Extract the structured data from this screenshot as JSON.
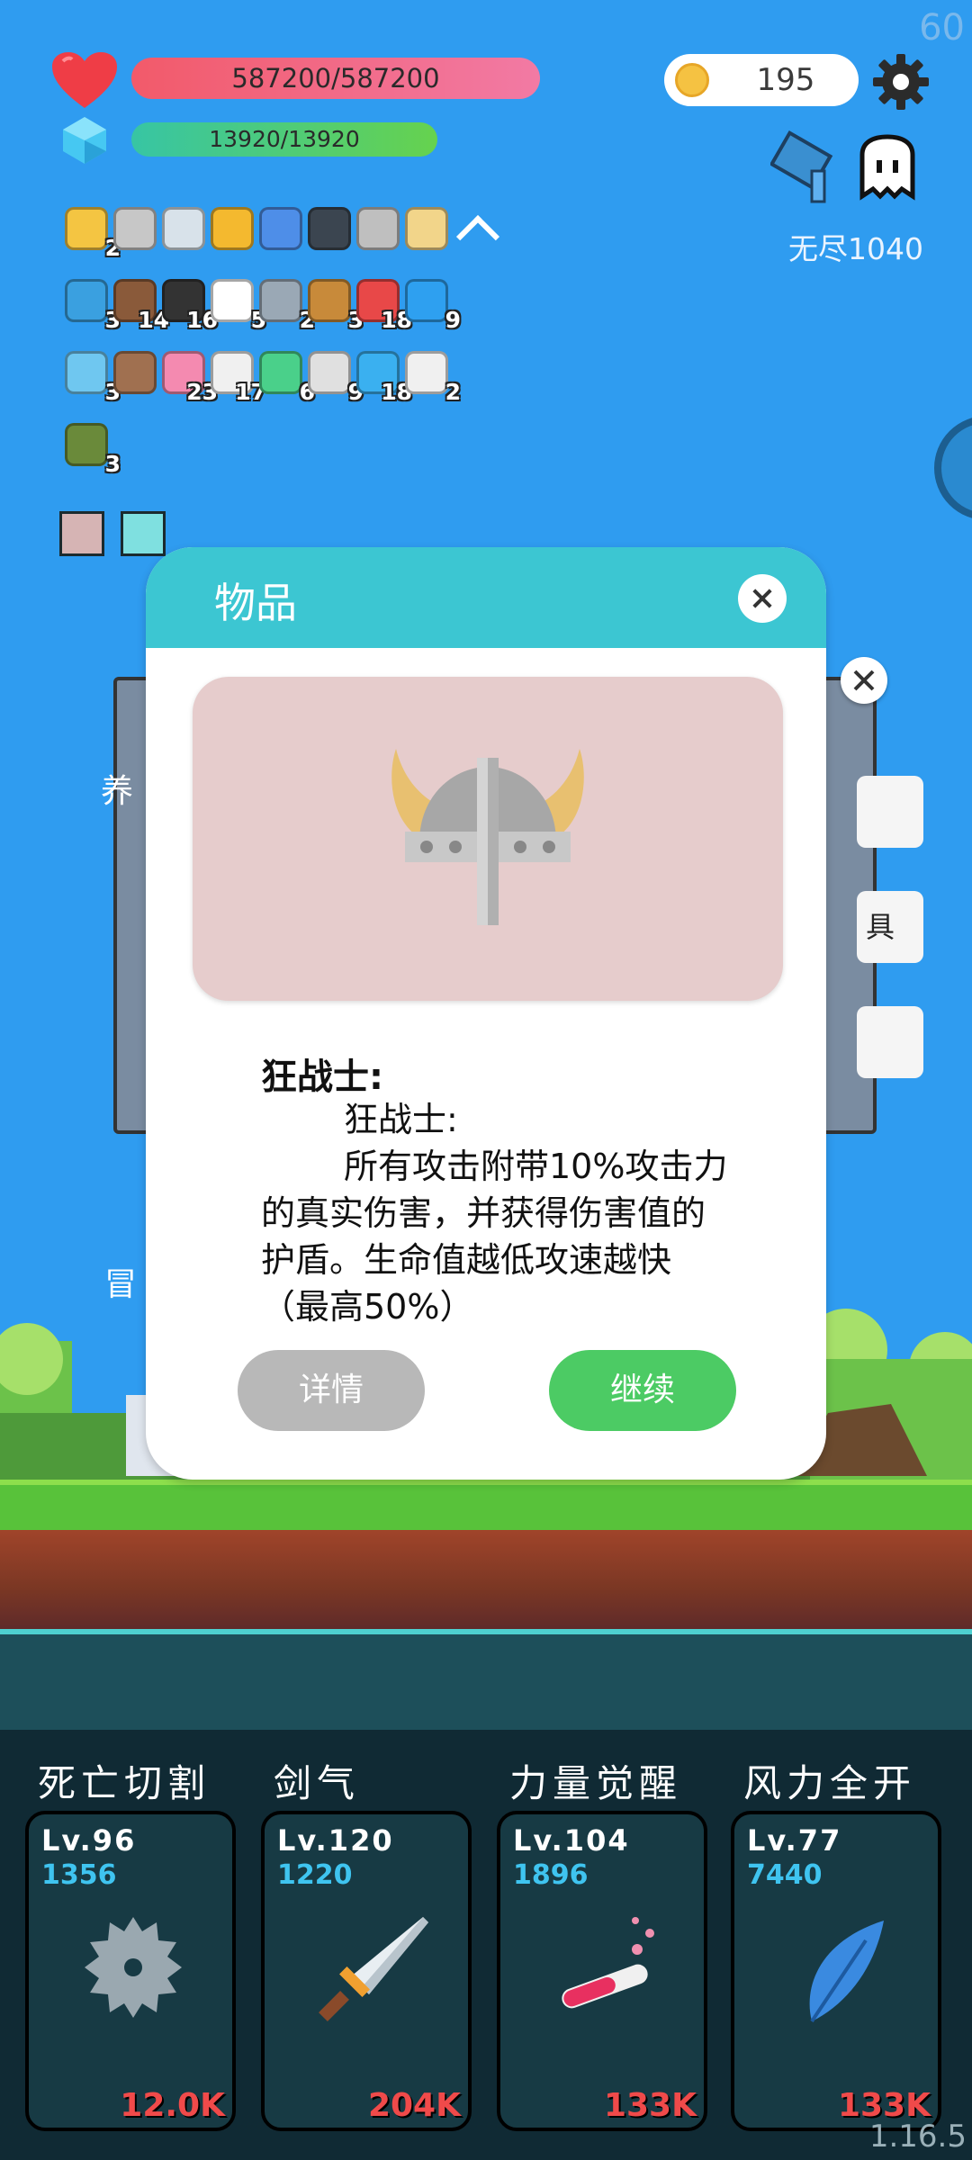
{
  "fps": "60",
  "version": "1.16.5",
  "status": {
    "hp": "587200/587200",
    "mp": "13920/13920",
    "coins": "195",
    "mode": "无尽1040"
  },
  "items_rows": [
    [
      {
        "icon": "sun-icon",
        "count": "2",
        "color": "#f4c542"
      },
      {
        "icon": "axe-icon",
        "count": "",
        "color": "#c7c7c7"
      },
      {
        "icon": "sword-icon",
        "count": "",
        "color": "#d8e2ea"
      },
      {
        "icon": "crown-icon",
        "count": "",
        "color": "#f4b92f"
      },
      {
        "icon": "cards-icon",
        "count": "",
        "color": "#4e8ee8"
      },
      {
        "icon": "skull-book-icon",
        "count": "",
        "color": "#3b4550"
      },
      {
        "icon": "viking-helmet-icon",
        "count": "",
        "color": "#bfbfbf"
      },
      {
        "icon": "map-icon",
        "count": "",
        "color": "#f2d58a"
      },
      {
        "icon": "chevron-up-icon",
        "count": "",
        "color": "#ffffff"
      }
    ],
    [
      {
        "icon": "target-icon",
        "count": "3",
        "color": "#3aa0e0"
      },
      {
        "icon": "coconut-icon",
        "count": "14",
        "color": "#8a5a3a"
      },
      {
        "icon": "cauldron-icon",
        "count": "16",
        "color": "#333333"
      },
      {
        "icon": "poker-cards-icon",
        "count": "5",
        "color": "#ffffff"
      },
      {
        "icon": "compass-icon",
        "count": "2",
        "color": "#9aa8b5"
      },
      {
        "icon": "bow-icon",
        "count": "3",
        "color": "#c88a3a"
      },
      {
        "icon": "watermelon-icon",
        "count": "18",
        "color": "#e84848"
      },
      {
        "icon": "sapphire-icon",
        "count": "9",
        "color": "#2ea0f0"
      }
    ],
    [
      {
        "icon": "potion-icon",
        "count": "3",
        "color": "#6fc7f0"
      },
      {
        "icon": "meteor-icon",
        "count": "",
        "color": "#a07050"
      },
      {
        "icon": "ice-cream-icon",
        "count": "23",
        "color": "#f48ab0"
      },
      {
        "icon": "cloud-icon",
        "count": "17",
        "color": "#f0f0f0"
      },
      {
        "icon": "alien-icon",
        "count": "6",
        "color": "#4ad08a"
      },
      {
        "icon": "bulb-icon",
        "count": "9",
        "color": "#e0e0e0"
      },
      {
        "icon": "chat-icon",
        "count": "18",
        "color": "#3ab0f0"
      },
      {
        "icon": "dice-icon",
        "count": "2",
        "color": "#f0f0f0"
      }
    ],
    [
      {
        "icon": "grenade-icon",
        "count": "3",
        "color": "#6a8a3a"
      }
    ]
  ],
  "equip_slots": [
    {
      "icon": "striped-tile-icon",
      "color": "#d6b4b4"
    },
    {
      "icon": "bulb-tile-icon",
      "color": "#7fe0e0"
    }
  ],
  "background_panel": {
    "text_fragment_left": "养",
    "text_fragment_below": "冒",
    "side_button_2": "具"
  },
  "modal": {
    "title": "物品",
    "item_name": "狂战士:",
    "desc_title": "狂战士:",
    "desc_body": "所有攻击附带10%攻击力的真实伤害，并获得伤害值的护盾。生命值越低攻速越快（最高50%）",
    "detail_button": "详情",
    "continue_button": "继续"
  },
  "skills": [
    {
      "name": "死亡切割",
      "level": "Lv.96",
      "value": "1356",
      "cost": "12.0K",
      "icon": "saw-blade-icon"
    },
    {
      "name": "剑气",
      "level": "Lv.120",
      "value": "1220",
      "cost": "204K",
      "icon": "sword-icon"
    },
    {
      "name": "力量觉醒",
      "level": "Lv.104",
      "value": "1896",
      "cost": "133K",
      "icon": "test-tube-icon"
    },
    {
      "name": "风力全开",
      "level": "Lv.77",
      "value": "7440",
      "cost": "133K",
      "icon": "feather-icon"
    }
  ]
}
